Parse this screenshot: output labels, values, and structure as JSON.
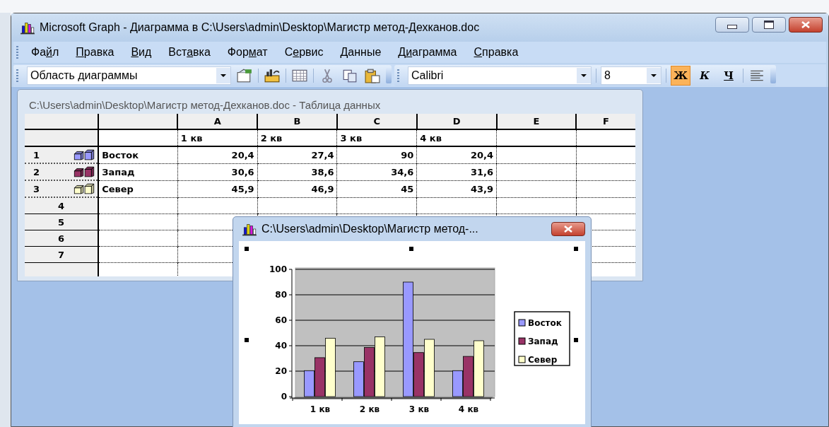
{
  "window": {
    "title": "Microsoft Graph - Диаграмма в C:\\Users\\admin\\Desktop\\Магистр метод-Дехканов.doc"
  },
  "menu": [
    {
      "before": "Фа",
      "access_key": "й",
      "after": "л"
    },
    {
      "access_key": "П",
      "after": "равка"
    },
    {
      "access_key": "В",
      "after": "ид"
    },
    {
      "before": "Вст",
      "access_key": "а",
      "after": "вка"
    },
    {
      "before": "Фор",
      "access_key": "м",
      "after": "ат"
    },
    {
      "before": "С",
      "access_key": "е",
      "after": "рвис"
    },
    {
      "access_key": "Д",
      "after": "анные"
    },
    {
      "before": "Д",
      "access_key": "и",
      "after": "аграмма"
    },
    {
      "access_key": "С",
      "after": "правка"
    }
  ],
  "toolbar": {
    "object_selector": "Область диаграммы",
    "font": "Calibri",
    "font_size": "8",
    "format_buttons": [
      {
        "kind": "bold",
        "label": "Ж",
        "selected": true
      },
      {
        "kind": "italic",
        "label": "К",
        "selected": false
      },
      {
        "kind": "underline",
        "label": "Ч",
        "selected": false
      }
    ]
  },
  "datasheet": {
    "title": "C:\\Users\\admin\\Desktop\\Магистр метод-Дехканов.doc - Таблица данных",
    "columns": [
      "A",
      "B",
      "C",
      "D",
      "E",
      "F"
    ],
    "category_row": [
      "1 кв",
      "2 кв",
      "3 кв",
      "4 кв"
    ],
    "series_rows": [
      {
        "number": "1",
        "name": "Восток",
        "color": "#9999ff",
        "values": [
          "20,4",
          "27,4",
          "90",
          "20,4"
        ]
      },
      {
        "number": "2",
        "name": "Запад",
        "color": "#993366",
        "values": [
          "30,6",
          "38,6",
          "34,6",
          "31,6"
        ]
      },
      {
        "number": "3",
        "name": "Север",
        "color": "#ffffcc",
        "values": [
          "45,9",
          "46,9",
          "45",
          "43,9"
        ]
      }
    ],
    "empty_rows": [
      "4",
      "5",
      "6",
      "7"
    ]
  },
  "chart_window": {
    "title": "C:\\Users\\admin\\Desktop\\Магистр метод-...",
    "chart_data": {
      "type": "bar",
      "categories": [
        "1 кв",
        "2 кв",
        "3 кв",
        "4 кв"
      ],
      "series": [
        {
          "name": "Восток",
          "color": "#9999ff",
          "values": [
            20.4,
            27.4,
            90,
            20.4
          ]
        },
        {
          "name": "Запад",
          "color": "#993366",
          "values": [
            30.6,
            38.6,
            34.6,
            31.6
          ]
        },
        {
          "name": "Север",
          "color": "#ffffcc",
          "values": [
            45.9,
            46.9,
            45,
            43.9
          ]
        }
      ],
      "ylim": [
        0,
        100
      ],
      "yticks": [
        0,
        20,
        40,
        60,
        80,
        100
      ],
      "grid": true,
      "legend": true
    }
  }
}
